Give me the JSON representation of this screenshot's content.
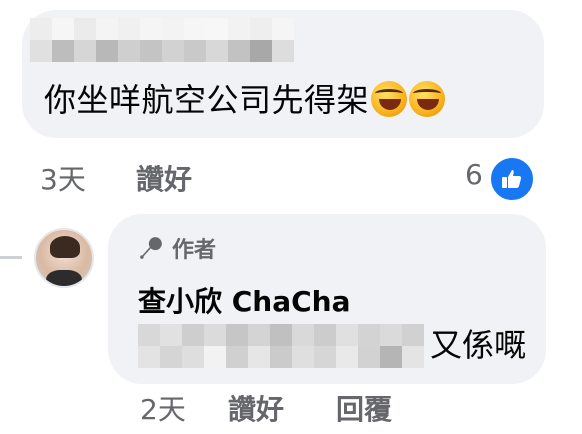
{
  "comments": [
    {
      "author_redacted": true,
      "text": "你坐咩航空公司先得架",
      "emojis": [
        "rolling-laughing-emoji",
        "rolling-laughing-emoji"
      ],
      "time": "3天",
      "like_label": "讚好",
      "reaction_count": "6",
      "reaction_icon": "thumbs-up-icon"
    },
    {
      "author_badge": "作者",
      "author_name": "查小欣 ChaCha",
      "text_redacted": true,
      "text_tail": "又係嘅",
      "time": "2天",
      "like_label": "讚好",
      "reply_label": "回覆"
    }
  ],
  "colors": {
    "bubble": "#f0f2f5",
    "meta_text": "#65676b",
    "like_blue": "#1877f2"
  }
}
